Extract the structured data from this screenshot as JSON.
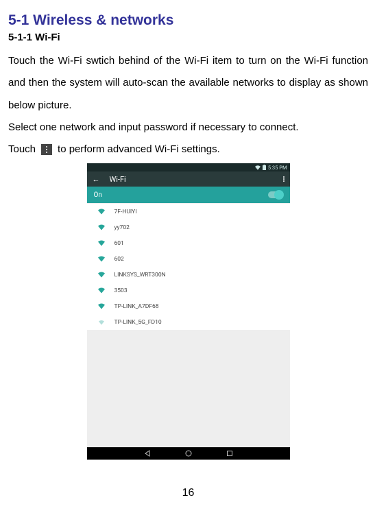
{
  "doc": {
    "heading1": "5-1 Wireless & networks",
    "heading2": "5-1-1 Wi-Fi",
    "p1": "Touch the Wi-Fi swtich behind of the Wi-Fi item to turn on the Wi-Fi function and then the system will auto-scan the available networks to display as shown below picture.",
    "p2": "Select one network and input password if necessary to connect.",
    "p3a": "Touch",
    "p3b": "to perform advanced Wi-Fi settings.",
    "page": "16"
  },
  "shot": {
    "statusTime": "5:35 PM",
    "appTitle": "Wi-Fi",
    "onLabel": "On",
    "networks": [
      "7F-HUIYI",
      "yy702",
      "601",
      "602",
      "LINKSYS_WRT300N",
      "3503",
      "TP-LINK_A7DF68",
      "TP-LINK_5G_FD10"
    ]
  }
}
